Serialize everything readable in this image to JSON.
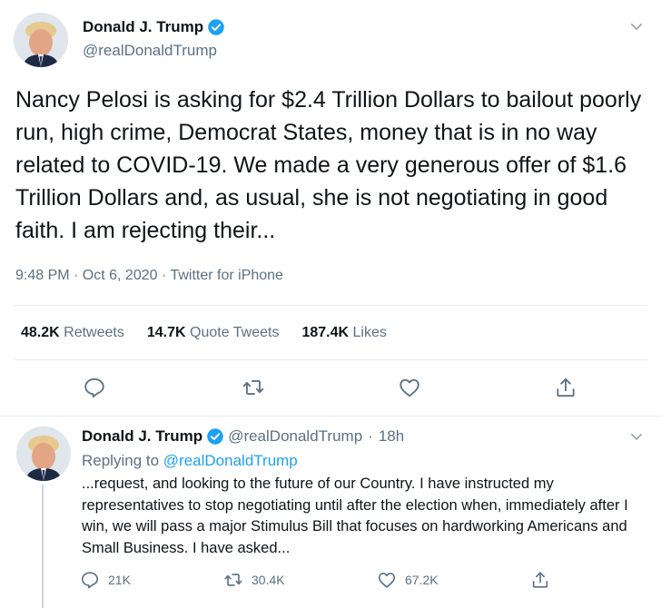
{
  "main_tweet": {
    "author": {
      "name": "Donald J. Trump",
      "handle": "@realDonaldTrump",
      "verified": true
    },
    "text": "Nancy Pelosi is asking for $2.4 Trillion Dollars to bailout poorly run, high crime, Democrat States, money that is in no way related to COVID-19. We made a very generous offer of $1.6 Trillion Dollars and, as usual, she is not negotiating in good faith. I am rejecting their...",
    "timestamp": "9:48 PM · Oct 6, 2020 · Twitter for iPhone",
    "stats": {
      "retweets_count": "48.2K",
      "retweets_label": "Retweets",
      "quote_tweets_count": "14.7K",
      "quote_tweets_label": "Quote Tweets",
      "likes_count": "187.4K",
      "likes_label": "Likes"
    },
    "actions": [
      "reply-icon",
      "retweet-icon",
      "like-icon",
      "share-icon"
    ]
  },
  "reply_tweet": {
    "author": {
      "name": "Donald J. Trump",
      "handle": "@realDonaldTrump",
      "verified": true
    },
    "separator": "·",
    "time": "18h",
    "replying_to_label": "Replying to",
    "replying_to_handle": "@realDonaldTrump",
    "text": "...request, and looking to the future of our Country. I have instructed my representatives to stop negotiating until after the election when, immediately after I win, we will pass a major Stimulus Bill that focuses on hardworking Americans and Small Business. I have asked...",
    "counts": {
      "replies": "21K",
      "retweets": "30.4K",
      "likes": "67.2K"
    }
  },
  "colors": {
    "accent": "#1da1f2",
    "secondary_text": "#5b7083",
    "primary_text": "#0f1419",
    "divider": "#e6ecf0"
  }
}
